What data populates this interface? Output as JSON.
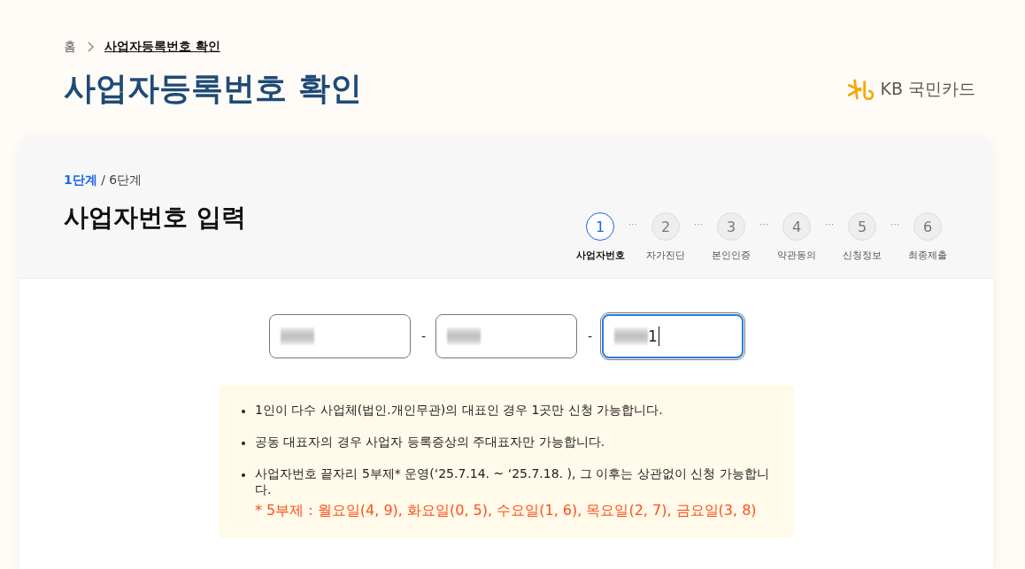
{
  "breadcrumb": [
    {
      "label": "홈",
      "current": false
    },
    {
      "label": "사업자등록번호 확인",
      "current": true
    }
  ],
  "title": "사업자등록번호 확인",
  "logo": {
    "text": "KB 국민카드"
  },
  "step_counter": {
    "current": "1단계",
    "total": " / 6단계"
  },
  "section_title": "사업자번호 입력",
  "steps": [
    {
      "number": "1",
      "label": "사업자번호",
      "selected": true
    },
    {
      "number": "2",
      "label": "자가진단",
      "selected": false
    },
    {
      "number": "3",
      "label": "본인인증",
      "selected": false
    },
    {
      "number": "4",
      "label": "약관동의",
      "selected": false
    },
    {
      "number": "5",
      "label": "신청정보",
      "selected": false
    },
    {
      "number": "6",
      "label": "최종제출",
      "selected": false
    }
  ],
  "step_separator": "···",
  "fields": [
    {
      "masked": true,
      "focused": false
    },
    {
      "masked": true,
      "focused": false
    },
    {
      "masked": true,
      "value": "1",
      "focused": true
    }
  ],
  "field_separator": "-",
  "notices": [
    {
      "text": "1인이 다수 사업체(법인.개인무관)의 대표인 경우 1곳만 신청 가능합니다."
    },
    {
      "text": "공동 대표자의 경우 사업자 등록증상의 주대표자만 가능합니다."
    },
    {
      "text": "사업자번호 끝자리 5부제* 운영(‘25.7.14. ~ ‘25.7.18. ), 그 이후는 상관없이 신청 가능합니다.",
      "note": "* 5부제 : 월요일(4, 9), 화요일(0, 5), 수요일(1, 6), 목요일(2, 7), 금요일(3, 8)"
    }
  ]
}
